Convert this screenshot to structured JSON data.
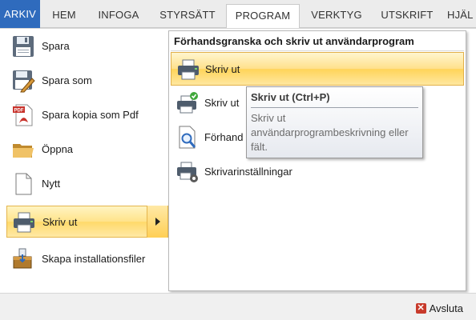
{
  "tabs": [
    {
      "label": "ARKIV"
    },
    {
      "label": "HEM"
    },
    {
      "label": "INFOGA"
    },
    {
      "label": "STYRSÄTT"
    },
    {
      "label": "PROGRAM"
    },
    {
      "label": "VERKTYG"
    },
    {
      "label": "UTSKRIFT"
    },
    {
      "label": "HJÄL"
    }
  ],
  "left_menu": [
    {
      "label": "Spara",
      "icon": "floppy-icon"
    },
    {
      "label": "Spara som",
      "icon": "save-as-icon"
    },
    {
      "label": "Spara kopia som Pdf",
      "icon": "pdf-icon"
    },
    {
      "label": "Öppna",
      "icon": "folder-icon"
    },
    {
      "label": "Nytt",
      "icon": "new-document-icon"
    },
    {
      "label": "Skriv ut",
      "icon": "printer-icon"
    },
    {
      "label": "Skapa installationsfiler",
      "icon": "installer-icon"
    }
  ],
  "submenu": {
    "header": "Förhandsgranska och skriv ut användarprogram",
    "items": [
      {
        "label": "Skriv ut",
        "icon": "printer-icon"
      },
      {
        "label": "Skriv ut",
        "icon": "printer-check-icon"
      },
      {
        "label": "Förhand",
        "icon": "preview-icon"
      },
      {
        "label": "Skrivarinställningar",
        "icon": "printer-settings-icon"
      }
    ]
  },
  "tooltip": {
    "title": "Skriv ut (Ctrl+P)",
    "text": "Skriv ut användarprogrambeskrivning eller fält."
  },
  "footer": {
    "exit_label": "Avsluta"
  },
  "colors": {
    "file_tab": "#2f6bbd",
    "highlight": "#ffe08a",
    "exit_icon": "#c83a2b"
  }
}
